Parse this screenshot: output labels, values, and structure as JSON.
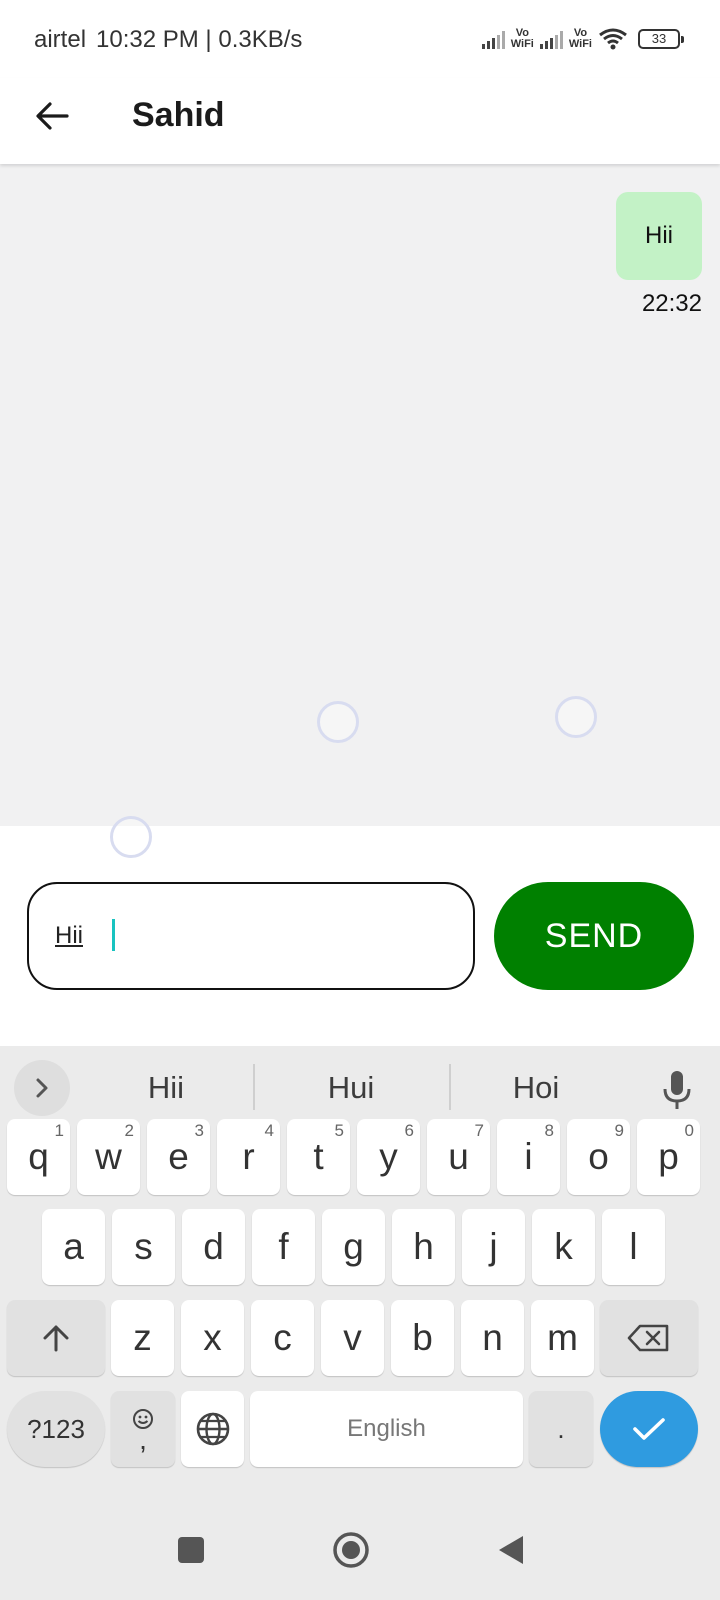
{
  "status_bar": {
    "carrier": "airtel",
    "time": "10:32 PM",
    "speed": "0.3KB/s",
    "vowifi_top": "Vo",
    "vowifi_bottom": "WiFi",
    "battery": "33"
  },
  "header": {
    "title": "Sahid",
    "back_icon": "arrow-left-icon"
  },
  "chat": {
    "messages": [
      {
        "text": "Hii",
        "time": "22:32",
        "outgoing": true
      }
    ]
  },
  "composer": {
    "input_value": "Hii",
    "send_label": "SEND"
  },
  "colors": {
    "send_button": "#008000",
    "outgoing_bubble": "#c3f2c6",
    "chat_background": "#f1f1f2",
    "keyboard_enter": "#2f9be0",
    "caret": "#18c3c0"
  },
  "keyboard": {
    "suggestions": [
      "Hii",
      "Hui",
      "Hoi"
    ],
    "row1": [
      {
        "key": "q",
        "hint": "1"
      },
      {
        "key": "w",
        "hint": "2"
      },
      {
        "key": "e",
        "hint": "3"
      },
      {
        "key": "r",
        "hint": "4"
      },
      {
        "key": "t",
        "hint": "5"
      },
      {
        "key": "y",
        "hint": "6"
      },
      {
        "key": "u",
        "hint": "7"
      },
      {
        "key": "i",
        "hint": "8"
      },
      {
        "key": "o",
        "hint": "9"
      },
      {
        "key": "p",
        "hint": "0"
      }
    ],
    "row2": [
      "a",
      "s",
      "d",
      "f",
      "g",
      "h",
      "j",
      "k",
      "l"
    ],
    "row3": [
      "z",
      "x",
      "c",
      "v",
      "b",
      "n",
      "m"
    ],
    "symbols_label": "?123",
    "comma_label": ",",
    "space_label": "English",
    "period_label": "."
  },
  "icons": {
    "suggestion_expand": "chevron-right-icon",
    "mic": "microphone-icon",
    "shift": "shift-icon",
    "backspace": "backspace-icon",
    "emoji": "emoji-icon",
    "language": "globe-icon",
    "enter": "checkmark-icon",
    "nav_recents": "square-icon",
    "nav_home": "home-circle-icon",
    "nav_back": "triangle-back-icon"
  }
}
